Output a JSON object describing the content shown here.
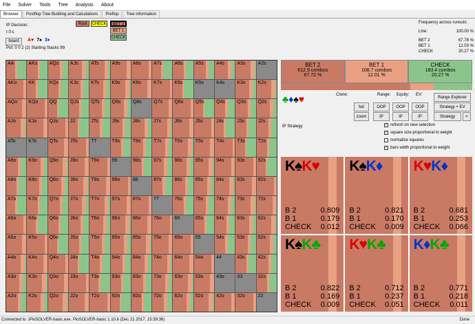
{
  "menu": [
    "File",
    "Solver",
    "Tools",
    "Tree",
    "Analysis",
    "About"
  ],
  "tabs": [
    "Browser",
    "Postflop Tree Building and Calculations",
    "Preflop",
    "Tree information"
  ],
  "ip_decision_label": "IP Decision:",
  "root_label": "r:0:c",
  "board_button": "board",
  "board_cards": [
    {
      "rank": "A",
      "suit": "♥",
      "color": "#d00"
    },
    {
      "rank": "7",
      "suit": "♠",
      "color": "#000"
    },
    {
      "rank": "3",
      "suit": "♦",
      "color": "#0033cc"
    }
  ],
  "pot_text": "Pot: 0 0 2 (2) Starting Stacks 99",
  "tree_nodes": {
    "root": "Root",
    "check": "CHECK",
    "bet2": "BET 2",
    "bet1": "BET 1",
    "check2": "CHECK"
  },
  "freq": {
    "title": "Frequency across runouts:",
    "line_label": "Line:",
    "line_value": "100.00 %",
    "rows": [
      {
        "name": "BET 2",
        "value": "67.78 %"
      },
      {
        "name": "BET 1",
        "value": "12.03 %"
      },
      {
        "name": "CHECK",
        "value": "20.27 %"
      }
    ]
  },
  "actions": [
    {
      "name": "BET 2",
      "combos": "612.9 combos",
      "pct": "67.72 %",
      "color": "#c97a65"
    },
    {
      "name": "BET 1",
      "combos": "108.7 combos",
      "pct": "12.01 %",
      "color": "#eaa083"
    },
    {
      "name": "CHECK",
      "combos": "183.4 combos",
      "pct": "20.27 %",
      "color": "#8cc58c"
    }
  ],
  "controls": {
    "clone": "Clone:",
    "range": "Range:",
    "equity": "Equity:",
    "ev": "EV:",
    "full": "full",
    "zoom": "zoom",
    "oop": "OOP",
    "ip": "IP",
    "range_explorer": "Range Explorer",
    "strategy_ev": "Strategy + EV",
    "strategy": "Strategy",
    "ip_strategy": "IP Strategy",
    "suits": [
      "♣",
      "♦",
      "♠",
      "♥"
    ]
  },
  "checks": [
    {
      "label": "refresh on new selection",
      "on": true
    },
    {
      "label": "square size proportional to weight",
      "on": true
    },
    {
      "label": "normalize squares",
      "on": false
    },
    {
      "label": "bars width proportional to weight",
      "on": true
    }
  ],
  "combos": [
    {
      "cards": [
        {
          "t": "K♠",
          "c": "#000"
        },
        {
          "t": "K♥",
          "c": "#d00"
        }
      ],
      "b2": "0.809",
      "b1": "0.179",
      "ck": "0.012"
    },
    {
      "cards": [
        {
          "t": "K♠",
          "c": "#000"
        },
        {
          "t": "K♦",
          "c": "#0033cc"
        }
      ],
      "b2": "0.821",
      "b1": "0.170",
      "ck": "0.009"
    },
    {
      "cards": [
        {
          "t": "K♥",
          "c": "#d00"
        },
        {
          "t": "K♦",
          "c": "#0033cc"
        }
      ],
      "b2": "0.681",
      "b1": "0.253",
      "ck": "0.066"
    },
    {
      "cards": [
        {
          "t": "K♠",
          "c": "#000"
        },
        {
          "t": "K♣",
          "c": "#0a0"
        }
      ],
      "b2": "0.822",
      "b1": "0.169",
      "ck": "0.009"
    },
    {
      "cards": [
        {
          "t": "K♥",
          "c": "#d00"
        },
        {
          "t": "K♣",
          "c": "#0a0"
        }
      ],
      "b2": "0.712",
      "b1": "0.237",
      "ck": "0.051"
    },
    {
      "cards": [
        {
          "t": "K♦",
          "c": "#0033cc"
        },
        {
          "t": "K♣",
          "c": "#0a0"
        }
      ],
      "b2": "0.771",
      "b1": "0.218",
      "ck": "0.011"
    }
  ],
  "combo_labels": {
    "b2": "B 2",
    "b1": "B 1",
    "ck": "CHECK"
  },
  "status": "Connected to .\\PioSOLVER-basic.exe. PioSOLVER-basic 1.10.6 (Dec 21 2017, 15:39:36)",
  "status_right": "Done",
  "hands": [
    [
      "AA",
      "AKs",
      "AQs",
      "AJs",
      "ATs",
      "A9s",
      "A8s",
      "A7s",
      "A6s",
      "A5s",
      "A4s",
      "A3s",
      "A2s"
    ],
    [
      "AKo",
      "KK",
      "KQs",
      "KJs",
      "KTs",
      "K9s",
      "K8s",
      "K7s",
      "K6s",
      "K5s",
      "K4s",
      "K3s",
      "K2s"
    ],
    [
      "AQo",
      "KQo",
      "QQ",
      "QJs",
      "QTs",
      "Q9s",
      "Q8s",
      "Q7s",
      "Q6s",
      "Q5s",
      "Q4s",
      "Q3s",
      "Q2s"
    ],
    [
      "AJo",
      "KJo",
      "QJo",
      "JJ",
      "JTs",
      "J9s",
      "J8s",
      "J7s",
      "J6s",
      "J5s",
      "J4s",
      "J3s",
      "J2s"
    ],
    [
      "ATo",
      "KTo",
      "QTo",
      "JTo",
      "TT",
      "T9s",
      "T8s",
      "T7s",
      "T6s",
      "T5s",
      "T4s",
      "T3s",
      "T2s"
    ],
    [
      "A9o",
      "K9o",
      "Q9o",
      "J9o",
      "T9o",
      "99",
      "98s",
      "97s",
      "96s",
      "95s",
      "94s",
      "93s",
      "92s"
    ],
    [
      "A8o",
      "K8o",
      "Q8o",
      "J8o",
      "T8o",
      "98o",
      "88",
      "87s",
      "86s",
      "85s",
      "84s",
      "83s",
      "82s"
    ],
    [
      "A7o",
      "K7o",
      "Q7o",
      "J7o",
      "T7o",
      "97o",
      "87o",
      "77",
      "76s",
      "75s",
      "74s",
      "73s",
      "72s"
    ],
    [
      "A6o",
      "K6o",
      "Q6o",
      "J6o",
      "T6o",
      "96o",
      "86o",
      "76o",
      "66",
      "65s",
      "64s",
      "63s",
      "62s"
    ],
    [
      "A5o",
      "K5o",
      "Q5o",
      "J5o",
      "T5o",
      "95o",
      "85o",
      "75o",
      "65o",
      "55",
      "54s",
      "53s",
      "52s"
    ],
    [
      "A4o",
      "K4o",
      "Q4o",
      "J4o",
      "T4o",
      "94o",
      "84o",
      "74o",
      "64o",
      "54o",
      "44",
      "43s",
      "42s"
    ],
    [
      "A3o",
      "K3o",
      "Q3o",
      "J3o",
      "T3o",
      "93o",
      "83o",
      "73o",
      "63o",
      "53o",
      "43o",
      "33",
      "32s"
    ],
    [
      "A2o",
      "K2o",
      "Q2o",
      "J2o",
      "T2o",
      "92o",
      "82o",
      "72o",
      "62o",
      "52o",
      "42o",
      "32o",
      "22"
    ]
  ],
  "hand_strategy": [
    [
      "B",
      "B",
      "B",
      "B",
      "B",
      "B",
      "B",
      "B",
      "B",
      "B",
      "B",
      "B",
      "g"
    ],
    [
      "B",
      "B",
      "B",
      "B",
      "B",
      "B",
      "B",
      "B",
      "B",
      "g",
      "g",
      "B",
      "B"
    ],
    [
      "B",
      "B",
      "B",
      "B",
      "B",
      "B",
      "g",
      "B",
      "B",
      "B",
      "B",
      "B",
      "B"
    ],
    [
      "B",
      "B",
      "B",
      "B",
      "B",
      "B",
      "B",
      "B",
      "B",
      "B",
      "B",
      "B",
      "B"
    ],
    [
      "g",
      "g",
      "B",
      "B",
      "g",
      "B",
      "B",
      "B",
      "B",
      "B",
      "B",
      "B",
      "B"
    ],
    [
      "B",
      "B",
      "B",
      "B",
      "B",
      "g",
      "B",
      "B",
      "B",
      "B",
      "B",
      "B",
      "B"
    ],
    [
      "B",
      "B",
      "B",
      "B",
      "B",
      "B",
      "g",
      "B",
      "B",
      "B",
      "B",
      "B",
      "B"
    ],
    [
      "B",
      "B",
      "B",
      "B",
      "B",
      "B",
      "B",
      "g",
      "B",
      "B",
      "B",
      "B",
      "B"
    ],
    [
      "B",
      "B",
      "B",
      "B",
      "B",
      "B",
      "B",
      "B",
      "g",
      "B",
      "B",
      "B",
      "B"
    ],
    [
      "B",
      "B",
      "B",
      "B",
      "B",
      "B",
      "B",
      "B",
      "B",
      "g",
      "B",
      "B",
      "B"
    ],
    [
      "B",
      "B",
      "B",
      "B",
      "B",
      "B",
      "B",
      "B",
      "B",
      "B",
      "g",
      "B",
      "B"
    ],
    [
      "B",
      "B",
      "B",
      "B",
      "B",
      "B",
      "B",
      "B",
      "B",
      "B",
      "g",
      "g",
      "B"
    ],
    [
      "B",
      "B",
      "B",
      "B",
      "B",
      "B",
      "B",
      "B",
      "B",
      "B",
      "B",
      "B",
      "g"
    ]
  ],
  "colors": {
    "bet2": "#c97a65",
    "bet1": "#eaa083",
    "check": "#8cc58c",
    "empty": "#8a8a8a",
    "root": "#c97a65",
    "check_node": "#ffff00"
  }
}
